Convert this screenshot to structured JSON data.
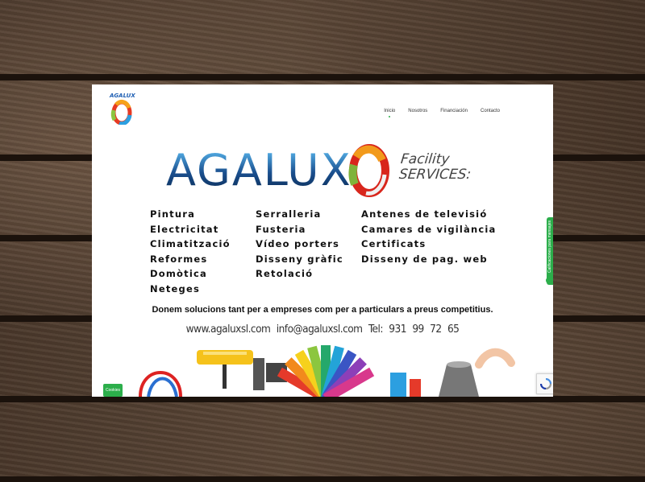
{
  "site": {
    "logo_text": "AGALUX",
    "nav": [
      "Inicio",
      "Nosotros",
      "Financiación",
      "Contacto"
    ],
    "active_nav": "Inicio"
  },
  "banner": {
    "title": "AGALUX",
    "tagline_line1": "Facility",
    "tagline_line2": "SERVICES:",
    "services_col1": [
      "Pintura",
      "Electricitat",
      "Climatització",
      "Reformes",
      "Domòtica",
      "Neteges"
    ],
    "services_col2": [
      "Serralleria",
      "Fusteria",
      "Vídeo porters",
      "Disseny gràfic",
      "Retolació"
    ],
    "services_col3": [
      "Antenes de televisió",
      "Camares de vigilància",
      "Certificats",
      "Disseny de pag. web"
    ],
    "subtitle": "Donem solucions  tant per a empreses  com per a  particulars a preus competitius.",
    "website": "www.agaluxsl.com",
    "email": "info@agaluxsl.com",
    "phone": "Tel: 931 99 72 65"
  },
  "side_tab_label": "Calificaciones para mensajes",
  "cookies_label": "Cookies",
  "colors": {
    "accent": "#2cae4b",
    "brand_blue": "#1a4f8e",
    "wood": "#4e3b2d"
  }
}
